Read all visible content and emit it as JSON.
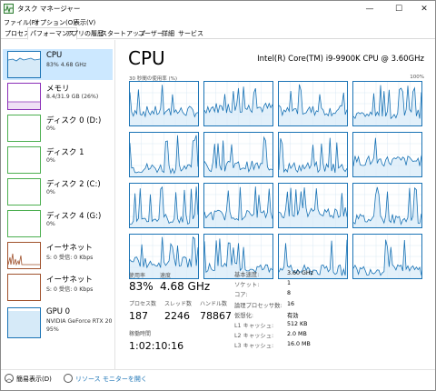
{
  "window": {
    "title": "タスク マネージャー",
    "minimize": "—",
    "maximize": "☐",
    "close": "✕"
  },
  "menu": [
    "ファイル(F)",
    "オプション(O)",
    "表示(V)"
  ],
  "tabs": [
    "プロセス",
    "パフォーマンス",
    "アプリの履歴",
    "スタートアップ",
    "ユーザー",
    "詳細",
    "サービス"
  ],
  "active_tab": 1,
  "sidebar": [
    {
      "name": "CPU",
      "sub": "83% 4.68 GHz",
      "sub2": "",
      "color": "#1a73b5"
    },
    {
      "name": "メモリ",
      "sub": "8.4/31.9 GB (26%)",
      "sub2": "",
      "color": "#8b2fb8"
    },
    {
      "name": "ディスク 0 (D:)",
      "sub": "0%",
      "sub2": "",
      "color": "#4caf50"
    },
    {
      "name": "ディスク 1",
      "sub": "0%",
      "sub2": "",
      "color": "#4caf50"
    },
    {
      "name": "ディスク 2 (C:)",
      "sub": "0%",
      "sub2": "",
      "color": "#4caf50"
    },
    {
      "name": "ディスク 4 (G:)",
      "sub": "0%",
      "sub2": "",
      "color": "#4caf50"
    },
    {
      "name": "イーサネット",
      "sub": "S: 0 受信: 0 Kbps",
      "sub2": "",
      "color": "#a0522d"
    },
    {
      "name": "イーサネット",
      "sub": "S: 0 受信: 0 Kbps",
      "sub2": "",
      "color": "#a0522d"
    },
    {
      "name": "GPU 0",
      "sub": "NVIDIA GeForce RTX 20",
      "sub2": "95%",
      "color": "#1a73b5"
    }
  ],
  "main": {
    "title": "CPU",
    "model": "Intel(R) Core(TM) i9-9900K CPU @ 3.60GHz",
    "util_label": "30 秒間の使用率 (%)",
    "util_max": "100%"
  },
  "stats": {
    "usage_label": "使用率",
    "usage": "83%",
    "speed_label": "速度",
    "speed": "4.68 GHz",
    "proc_label": "プロセス数",
    "proc": "187",
    "thread_label": "スレッド数",
    "thread": "2246",
    "handle_label": "ハンドル数",
    "handle": "78867",
    "uptime_label": "稼働時間",
    "uptime": "1:02:10:16"
  },
  "info": [
    {
      "k": "基本速度:",
      "v": "3.60 GHz"
    },
    {
      "k": "ソケット:",
      "v": "1"
    },
    {
      "k": "コア:",
      "v": "8"
    },
    {
      "k": "論理プロセッサ数:",
      "v": "16"
    },
    {
      "k": "仮想化:",
      "v": "有効"
    },
    {
      "k": "L1 キャッシュ:",
      "v": "512 KB"
    },
    {
      "k": "L2 キャッシュ:",
      "v": "2.0 MB"
    },
    {
      "k": "L3 キャッシュ:",
      "v": "16.0 MB"
    }
  ],
  "footer": {
    "less": "簡易表示(D)",
    "monitor": "リソース モニターを開く"
  },
  "colors": {
    "accent": "#1a73b5",
    "selected": "#cce8ff",
    "memory": "#8b2fb8",
    "disk": "#4caf50",
    "net": "#a0522d"
  }
}
